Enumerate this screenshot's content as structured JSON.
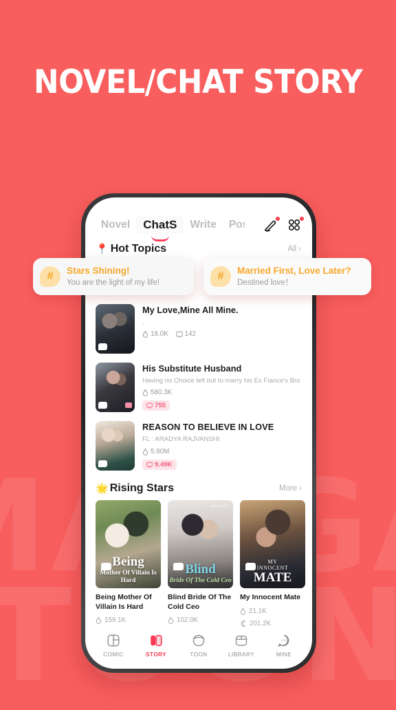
{
  "headline": {
    "text": "NOVEL/CHAT STORY"
  },
  "background": {
    "color": "#f95e5e",
    "watermark_lines": [
      "MANGA",
      "TOON"
    ]
  },
  "phone": {
    "topbar": {
      "tabs": [
        {
          "label": "Novel",
          "active": false
        },
        {
          "label": "ChatS",
          "active": true
        },
        {
          "label": "Write",
          "active": false
        },
        {
          "label": "Post",
          "active": false
        }
      ],
      "icons": [
        {
          "name": "pencil-icon",
          "badge": true
        },
        {
          "name": "grid-icon",
          "badge": true
        }
      ]
    },
    "hot_topics_section": {
      "emoji": "📍",
      "title": "Hot Topics",
      "more_label": "All",
      "chevron": "›",
      "cards": [
        {
          "hash": "#",
          "title": "Stars Shining!",
          "subtitle": "You are the light of my life!"
        },
        {
          "hash": "#",
          "title": "Married First, Love Later?",
          "subtitle": "Destined love！"
        }
      ]
    },
    "story_list": [
      {
        "title": "My Love,Mine All Mine.",
        "desc": ".",
        "stats": [
          {
            "icon": "🔥",
            "value": "18.0K"
          },
          {
            "icon": "💬",
            "value": "142"
          }
        ],
        "badge": null
      },
      {
        "title": "His Substitute Husband",
        "desc": "Having no Choice left but to marry his Ex Fiance's Bro",
        "stats": [
          {
            "icon": "🔥",
            "value": "580.3K"
          }
        ],
        "badge": "755"
      },
      {
        "title": "REASON TO BELIEVE IN LOVE",
        "desc": "FL : ARADYA RAJVANSHI",
        "stats": [
          {
            "icon": "🔥",
            "value": "5.90M"
          }
        ],
        "badge": "9.49K"
      }
    ],
    "rising_stars": {
      "emoji": "🌟",
      "title": "Rising Stars",
      "more_label": "More",
      "chevron": "›",
      "cards": [
        {
          "cover_eyebrow": "",
          "cover_main": "Being",
          "cover_sub": "Mother Of Villain Is Hard",
          "cover_tag": "",
          "name": "Being Mother Of Villain Is Hard",
          "stats": [
            "159.1K"
          ]
        },
        {
          "cover_eyebrow": "",
          "cover_main": "Blind",
          "cover_sub": "Bride Of The Cold Ceo",
          "cover_tag": "Oum-ta Girl",
          "name": "Blind Bride Of The Cold Ceo",
          "stats": [
            "102.0K"
          ]
        },
        {
          "cover_eyebrow": "MY",
          "cover_main": "MATE",
          "cover_sub": "INNOCENT",
          "cover_tag": "",
          "name": "My Innocent Mate",
          "stats": [
            "21.1K",
            "201.2K"
          ]
        }
      ]
    },
    "bottom_nav": [
      {
        "label": "COMIC",
        "icon": "comic-icon",
        "active": false
      },
      {
        "label": "STORY",
        "icon": "story-icon",
        "active": true
      },
      {
        "label": "TOON",
        "icon": "toon-icon",
        "active": false
      },
      {
        "label": "LIBRARY",
        "icon": "library-icon",
        "active": false
      },
      {
        "label": "MINE",
        "icon": "mine-icon",
        "active": false
      }
    ]
  },
  "colors": {
    "brand_red": "#f95e5e",
    "accent_pink": "#fb3b55",
    "topic_orange": "#f7a82a",
    "badge_pink": "#f4607e"
  }
}
